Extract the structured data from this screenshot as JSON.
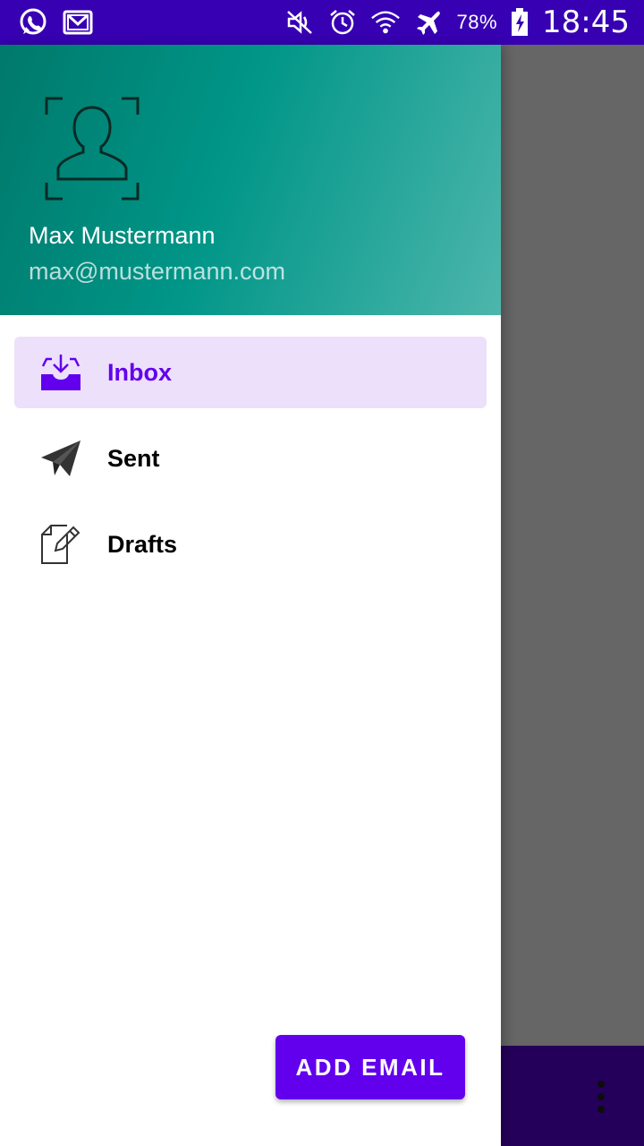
{
  "status_bar": {
    "battery": "78%",
    "time": "18:45",
    "left_icons": [
      "whatsapp-icon",
      "gmail-icon"
    ],
    "right_icons": [
      "mute-icon",
      "alarm-icon",
      "wifi-icon",
      "airplane-icon",
      "battery-charging-icon"
    ]
  },
  "drawer": {
    "user": {
      "name": "Max Mustermann",
      "email": "max@mustermann.com"
    },
    "items": [
      {
        "label": "Inbox",
        "icon": "inbox-icon",
        "active": true
      },
      {
        "label": "Sent",
        "icon": "send-icon",
        "active": false
      },
      {
        "label": "Drafts",
        "icon": "drafts-icon",
        "active": false
      }
    ],
    "add_button_label": "ADD EMAIL"
  },
  "colors": {
    "status_bar": "#3700b3",
    "primary": "#6200ee",
    "active_bg": "#ede0fb",
    "header_start": "#00796b",
    "header_end": "#4db6ac",
    "scrim": "#666666",
    "bottom_bar": "#25005a"
  }
}
